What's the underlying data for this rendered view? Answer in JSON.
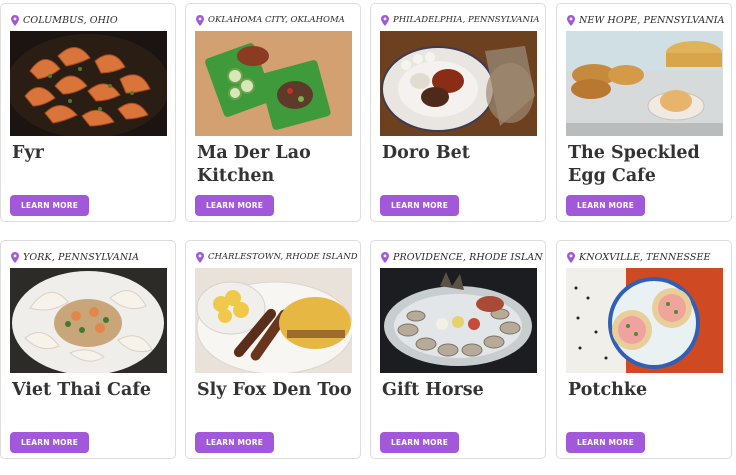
{
  "accent": "#a259d9",
  "cards": [
    {
      "location": "COLUMBUS, OHIO",
      "name": "Fyr",
      "cta": "LEARN MORE"
    },
    {
      "location": "OKLAHOMA CITY, OKLAHOMA",
      "name": "Ma Der Lao Kitchen",
      "cta": "LEARN MORE"
    },
    {
      "location": "PHILADELPHIA, PENNSYLVANIA",
      "name": "Doro Bet",
      "cta": "LEARN MORE"
    },
    {
      "location": "NEW HOPE, PENNSYLVANIA",
      "name": "The Speckled Egg Cafe",
      "cta": "LEARN MORE"
    },
    {
      "location": "YORK, PENNSYLVANIA",
      "name": "Viet Thai Cafe",
      "cta": "LEARN MORE"
    },
    {
      "location": "CHARLESTOWN, RHODE ISLAND",
      "name": "Sly Fox Den Too",
      "cta": "LEARN MORE"
    },
    {
      "location": "PROVIDENCE, RHODE ISLAND",
      "name": "Gift Horse",
      "cta": "LEARN MORE"
    },
    {
      "location": "KNOXVILLE, TENNESSEE",
      "name": "Potchke",
      "cta": "LEARN MORE"
    }
  ]
}
